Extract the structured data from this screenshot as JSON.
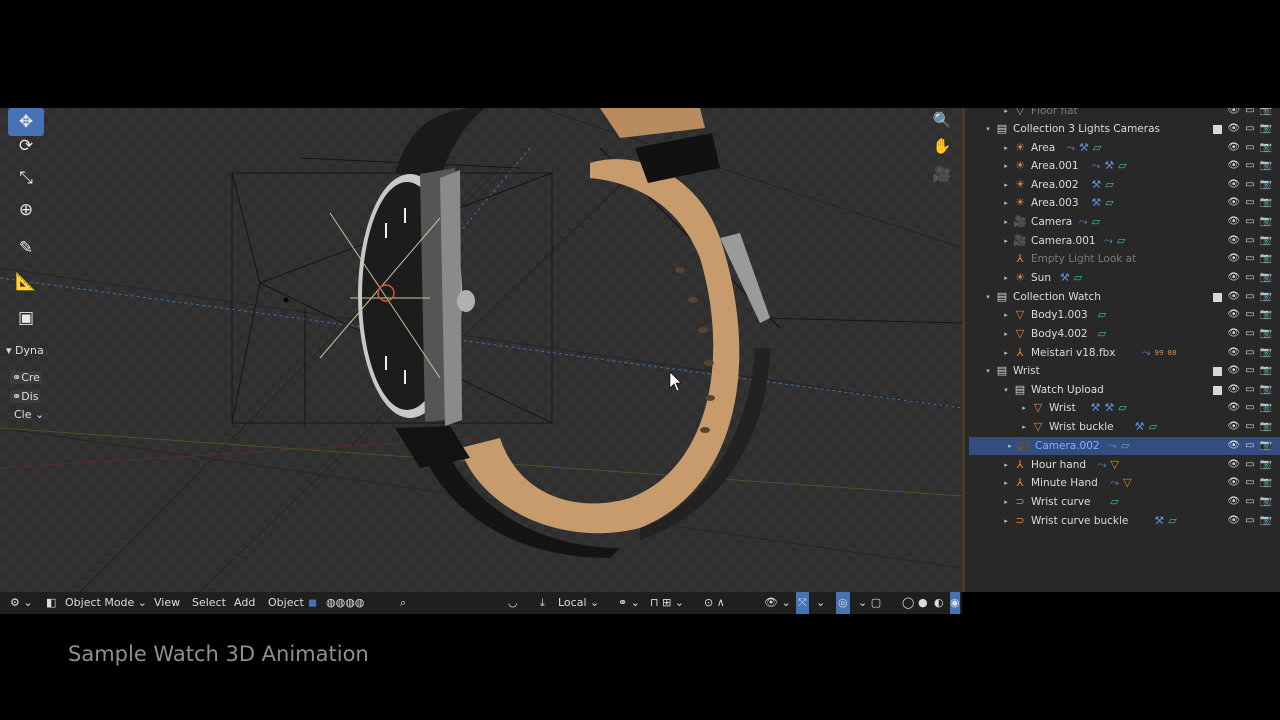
{
  "toolbar": {
    "panel_label": "Dyna",
    "btn1": "Cre",
    "btn2": "Dis",
    "dropdown": "Cle"
  },
  "outliner": {
    "rows": [
      {
        "label": "Floor flat",
        "dim": true
      },
      {
        "label": "Collection 3 Lights Cameras"
      },
      {
        "label": "Area"
      },
      {
        "label": "Area.001"
      },
      {
        "label": "Area.002"
      },
      {
        "label": "Area.003"
      },
      {
        "label": "Camera"
      },
      {
        "label": "Camera.001"
      },
      {
        "label": "Empty Light Look at",
        "dim": true
      },
      {
        "label": "Sun"
      },
      {
        "label": "Collection Watch"
      },
      {
        "label": "Body1.003"
      },
      {
        "label": "Body4.002"
      },
      {
        "label": "Meistari v18.fbx",
        "badge1": "99",
        "badge2": "88"
      },
      {
        "label": "Wrist"
      },
      {
        "label": "Watch Upload"
      },
      {
        "label": "Wrist"
      },
      {
        "label": "Wrist buckle"
      },
      {
        "label": "Camera.002",
        "selected": true
      },
      {
        "label": "Hour hand"
      },
      {
        "label": "Minute Hand"
      },
      {
        "label": "Wrist curve"
      },
      {
        "label": "Wrist curve buckle"
      }
    ]
  },
  "header": {
    "mode": "Object Mode",
    "view": "View",
    "select": "Select",
    "add": "Add",
    "object": "Object",
    "orientation": "Local"
  },
  "caption": "Sample Watch 3D Animation",
  "colors": {
    "accent": "#4772b3",
    "selected_row": "#334d80",
    "object_orange": "#e08a3c",
    "modifier_blue": "#5b8fd8",
    "data_green": "#3bc48e"
  }
}
